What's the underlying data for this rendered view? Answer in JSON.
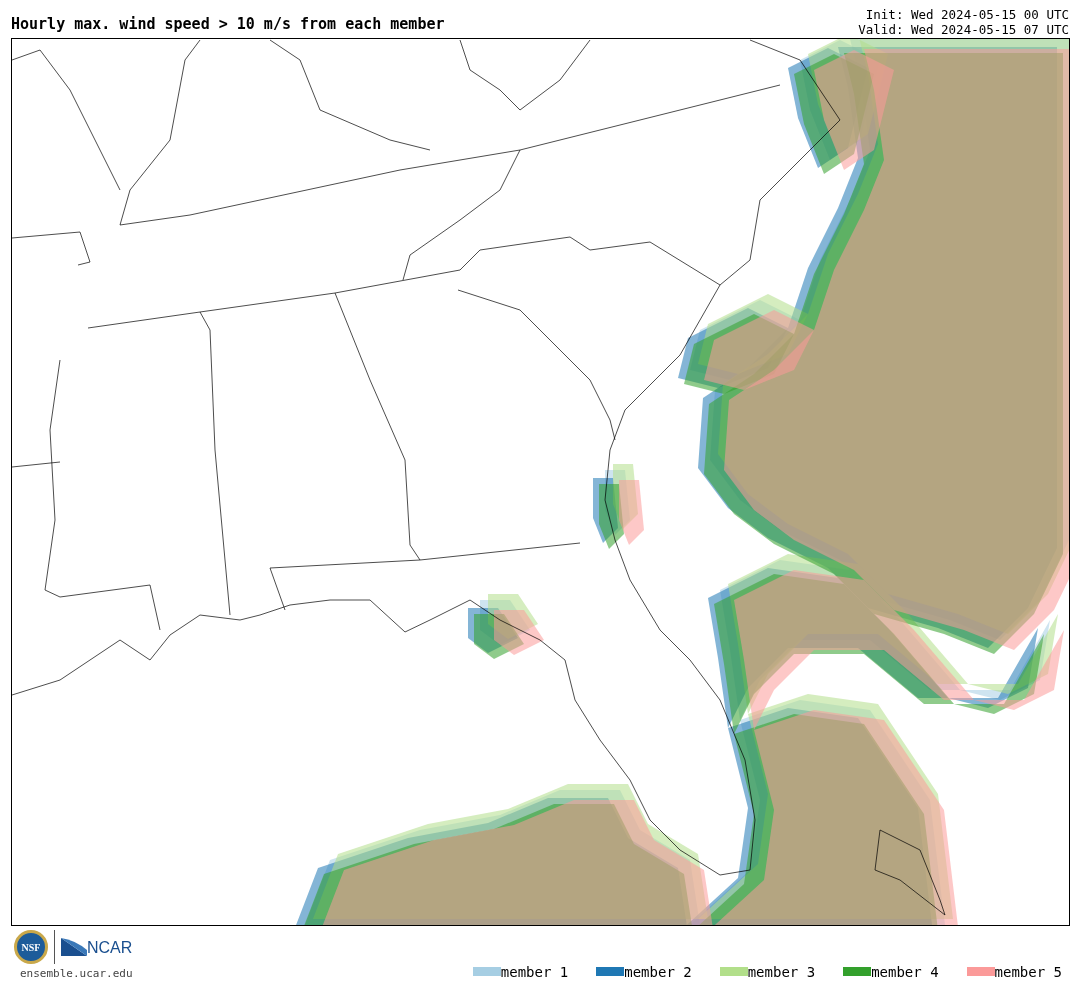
{
  "title": "Hourly max. wind speed > 10 m/s from each member",
  "init": "Init: Wed 2024-05-15 00 UTC",
  "valid": "Valid: Wed 2024-05-15 07 UTC",
  "logos": {
    "nsf": "NSF",
    "ncar": "NCAR"
  },
  "site": "ensemble.ucar.edu",
  "legend": [
    {
      "label": "member 1",
      "color": "#a6cee3"
    },
    {
      "label": "member 2",
      "color": "#1f78b4"
    },
    {
      "label": "member 3",
      "color": "#b2df8a"
    },
    {
      "label": "member 4",
      "color": "#33a02c"
    },
    {
      "label": "member 5",
      "color": "#fb9a99"
    }
  ]
}
